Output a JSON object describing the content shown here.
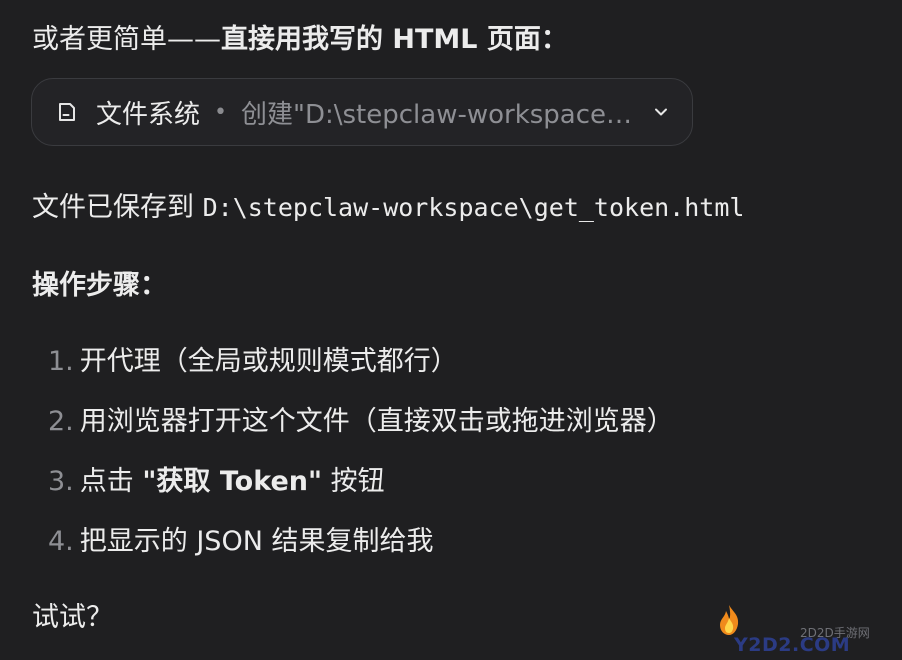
{
  "message": {
    "intro_prefix": "或者更简单——",
    "intro_strong": "直接用我写的 HTML 页面：",
    "tool_card": {
      "icon": "file-icon",
      "label": "文件系统",
      "separator": "•",
      "description": "创建\"D:\\stepclaw-workspace\\get_token.html\"",
      "chevron": "chevron-down-icon"
    },
    "saved_prefix": "文件已保存到 ",
    "saved_path": "D:\\stepclaw-workspace\\get_token.html",
    "steps_heading": "操作步骤：",
    "steps": [
      {
        "num": "1.",
        "text": "开代理（全局或规则模式都行）"
      },
      {
        "num": "2.",
        "text": "用浏览器打开这个文件（直接双击或拖进浏览器）"
      },
      {
        "num": "3.",
        "text_before": "点击 ",
        "text_strong": "\"获取 Token\"",
        "text_after": " 按钮"
      },
      {
        "num": "4.",
        "text": "把显示的 JSON 结果复制给我"
      }
    ],
    "outro": "试试？"
  },
  "watermark": {
    "cn": "2D2D手游网",
    "en": "Y2D2.COM"
  }
}
